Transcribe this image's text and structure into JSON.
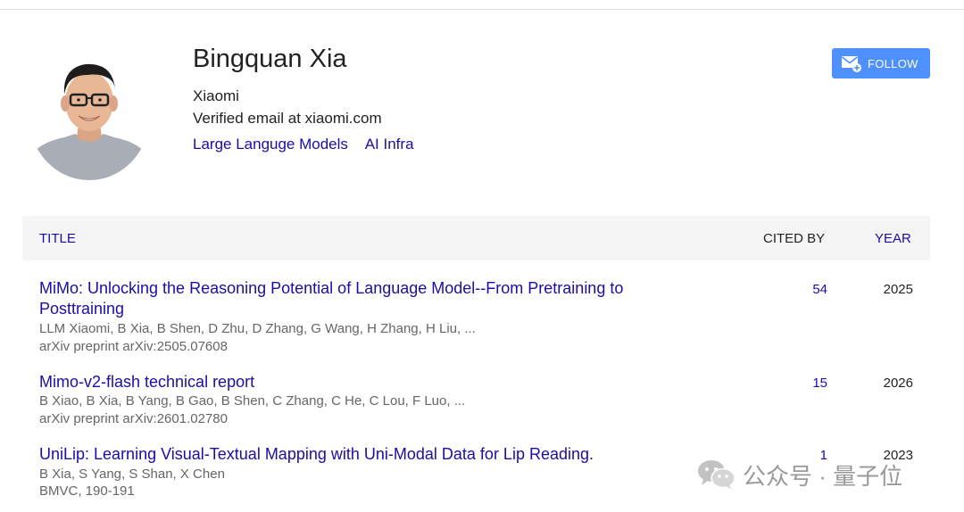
{
  "profile": {
    "name": "Bingquan Xia",
    "affiliation": "Xiaomi",
    "email": "Verified email at xiaomi.com",
    "interests": [
      "Large Languge Models",
      "AI Infra"
    ],
    "avatar_icon": "person-photo"
  },
  "follow_button": {
    "label": "FOLLOW",
    "icon": "mail-plus-icon",
    "color": "#4d90fe"
  },
  "table": {
    "headers": {
      "title": "TITLE",
      "cited_by": "CITED BY",
      "year": "YEAR"
    },
    "rows": [
      {
        "title": "MiMo: Unlocking the Reasoning Potential of Language Model--From Pretraining to Posttraining",
        "authors": "LLM Xiaomi, B Xia, B Shen, D Zhu, D Zhang, G Wang, H Zhang, H Liu, ...",
        "venue": "arXiv preprint arXiv:2505.07608",
        "cited_by": "54",
        "year": "2025"
      },
      {
        "title": "Mimo-v2-flash technical report",
        "authors": "B Xiao, B Xia, B Yang, B Gao, B Shen, C Zhang, C He, C Lou, F Luo, ...",
        "venue": "arXiv preprint arXiv:2601.02780",
        "cited_by": "15",
        "year": "2026"
      },
      {
        "title": "UniLip: Learning Visual-Textual Mapping with Uni-Modal Data for Lip Reading.",
        "authors": "B Xia, S Yang, S Shan, X Chen",
        "venue": "BMVC, 190-191",
        "cited_by": "1",
        "year": "2023"
      }
    ]
  },
  "watermark": {
    "text": "公众号 · 量子位",
    "icon": "wechat-icon"
  },
  "colors": {
    "link": "#1a0dab",
    "header_bg": "#f5f5f5",
    "muted": "#666666"
  }
}
